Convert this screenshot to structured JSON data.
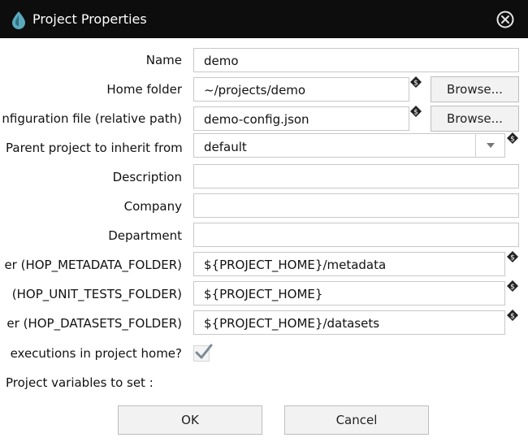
{
  "window": {
    "title": "Project Properties"
  },
  "fields": {
    "name": {
      "label": "Name",
      "value": "demo"
    },
    "home_folder": {
      "label": "Home folder",
      "value": "~/projects/demo"
    },
    "config_file": {
      "label": "nfiguration file (relative path)",
      "value": "demo-config.json"
    },
    "parent_project": {
      "label": "Parent project to inherit from",
      "value": "default"
    },
    "description": {
      "label": "Description",
      "value": ""
    },
    "company": {
      "label": "Company",
      "value": ""
    },
    "department": {
      "label": "Department",
      "value": ""
    },
    "metadata_folder": {
      "label": "er (HOP_METADATA_FOLDER)",
      "value": "${PROJECT_HOME}/metadata"
    },
    "unit_tests_folder": {
      "label": "(HOP_UNIT_TESTS_FOLDER)",
      "value": "${PROJECT_HOME}"
    },
    "datasets_folder": {
      "label": "er (HOP_DATASETS_FOLDER)",
      "value": "${PROJECT_HOME}/datasets"
    }
  },
  "enforce_executions": {
    "label": "executions in project home?",
    "checked": true
  },
  "project_variables": {
    "label": "Project variables to set :"
  },
  "browse_label": "Browse...",
  "buttons": {
    "ok": "OK",
    "cancel": "Cancel"
  },
  "icons": {
    "app": "hop-logo-icon",
    "close": "close-circle-icon",
    "variable": "variable-dollar-icon",
    "dropdown": "chevron-down-icon",
    "check": "checkmark-icon"
  },
  "colors": {
    "titlebar": "#0d0d0d",
    "logo": "#5aa8bb",
    "button_bg": "#f2f2f2",
    "check": "#7a8b98"
  }
}
